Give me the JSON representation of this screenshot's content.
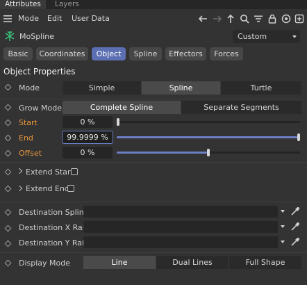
{
  "panel_tabs": [
    "Attributes",
    "Layers"
  ],
  "menu": [
    "Mode",
    "Edit",
    "User Data"
  ],
  "object": {
    "name": "MoSpline",
    "icon": "mospline-icon",
    "preset": "Custom"
  },
  "tabs": [
    {
      "label": "Basic",
      "active": false
    },
    {
      "label": "Coordinates",
      "active": false
    },
    {
      "label": "Object",
      "active": true
    },
    {
      "label": "Spline",
      "active": false
    },
    {
      "label": "Effectors",
      "active": false
    },
    {
      "label": "Forces",
      "active": false
    }
  ],
  "section_title": "Object Properties",
  "mode": {
    "label": "Mode",
    "options": [
      "Simple",
      "Spline",
      "Turtle"
    ],
    "selected": "Spline"
  },
  "grow_mode": {
    "label": "Grow Mode",
    "options": [
      "Complete Spline",
      "Separate Segments"
    ],
    "selected": "Complete Spline"
  },
  "start": {
    "label": "Start",
    "value": "0 %",
    "slider": 0.0
  },
  "end": {
    "label": "End",
    "value": "99.9999 %",
    "slider": 0.999999
  },
  "offset": {
    "label": "Offset",
    "value": "0 %",
    "slider": 0.5
  },
  "extend_start": {
    "label": "Extend Start",
    "checked": false
  },
  "extend_end": {
    "label": "Extend End",
    "checked": false
  },
  "destination_spline": {
    "label": "Destination Spline",
    "value": ""
  },
  "destination_x_rail": {
    "label": "Destination X Rail",
    "value": ""
  },
  "destination_y_rail": {
    "label": "Destination Y Rail",
    "value": ""
  },
  "display_mode": {
    "label": "Display Mode",
    "options": [
      "Line",
      "Dual Lines",
      "Full Shape"
    ],
    "selected": "Line"
  },
  "colors": {
    "accent": "#5b6fb2",
    "animated_label": "#e8963c",
    "slider_fill": "#6d7fc4",
    "background": "#333333"
  }
}
